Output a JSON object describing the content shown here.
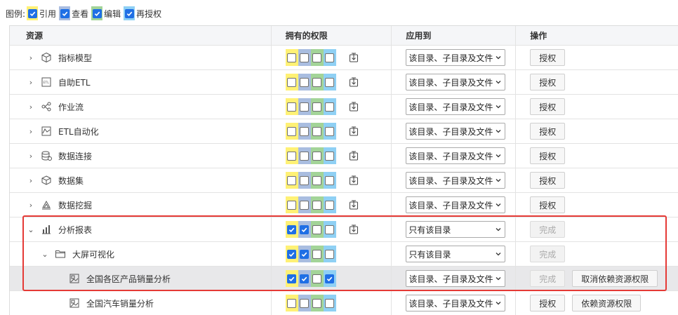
{
  "legend": {
    "prefix": "图例:",
    "items": [
      {
        "label": "引用",
        "color": "#fff175"
      },
      {
        "label": "查看",
        "color": "#a9bde0"
      },
      {
        "label": "编辑",
        "color": "#a3d498"
      },
      {
        "label": "再授权",
        "color": "#8fd0f4"
      }
    ]
  },
  "table": {
    "headers": {
      "resource": "资源",
      "permissions": "拥有的权限",
      "apply_to": "应用到",
      "actions": "操作"
    },
    "rows": [
      {
        "label": "指标模型",
        "expander": "›",
        "icon": "cube-icon",
        "perms": [
          false,
          false,
          false,
          false
        ],
        "inherit": true,
        "apply": "该目录、子目录及文件",
        "actions": [
          "授权"
        ],
        "disabled": [
          false
        ]
      },
      {
        "label": "自助ETL",
        "expander": "›",
        "icon": "etl-icon",
        "perms": [
          false,
          false,
          false,
          false
        ],
        "inherit": true,
        "apply": "该目录、子目录及文件",
        "actions": [
          "授权"
        ],
        "disabled": [
          false
        ]
      },
      {
        "label": "作业流",
        "expander": "›",
        "icon": "workflow-icon",
        "perms": [
          false,
          false,
          false,
          false
        ],
        "inherit": true,
        "apply": "该目录、子目录及文件",
        "actions": [
          "授权"
        ],
        "disabled": [
          false
        ]
      },
      {
        "label": "ETL自动化",
        "expander": "›",
        "icon": "etl-automation-icon",
        "perms": [
          false,
          false,
          false,
          false
        ],
        "inherit": true,
        "apply": "该目录、子目录及文件",
        "actions": [
          "授权"
        ],
        "disabled": [
          false
        ]
      },
      {
        "label": "数据连接",
        "expander": "›",
        "icon": "database-icon",
        "perms": [
          false,
          false,
          false,
          false
        ],
        "inherit": true,
        "apply": "该目录、子目录及文件",
        "actions": [
          "授权"
        ],
        "disabled": [
          false
        ]
      },
      {
        "label": "数据集",
        "expander": "›",
        "icon": "dataset-icon",
        "perms": [
          false,
          false,
          false,
          false
        ],
        "inherit": true,
        "apply": "该目录、子目录及文件",
        "actions": [
          "授权"
        ],
        "disabled": [
          false
        ]
      },
      {
        "label": "数据挖掘",
        "expander": "›",
        "icon": "mining-icon",
        "perms": [
          false,
          false,
          false,
          false
        ],
        "inherit": true,
        "apply": "该目录、子目录及文件",
        "actions": [
          "授权"
        ],
        "disabled": [
          false
        ]
      },
      {
        "label": "分析报表",
        "expander": "⌄",
        "icon": "report-icon",
        "perms": [
          true,
          true,
          false,
          false
        ],
        "inherit": true,
        "apply": "只有该目录",
        "actions": [
          "完成"
        ],
        "disabled": [
          true
        ]
      },
      {
        "label": "大屏可视化",
        "expander": "⌄",
        "icon": "folder-icon",
        "perms": [
          true,
          true,
          false,
          false
        ],
        "inherit": false,
        "apply": "只有该目录",
        "actions": [
          "完成"
        ],
        "disabled": [
          true
        ]
      },
      {
        "label": "全国各区产品销量分析",
        "expander": "",
        "icon": "image-icon",
        "perms": [
          true,
          true,
          false,
          true
        ],
        "inherit": false,
        "apply": "该目录、子目录及文件",
        "actions": [
          "完成",
          "取消依赖资源权限"
        ],
        "disabled": [
          true,
          false
        ],
        "selected": true
      },
      {
        "label": "全国汽车销量分析",
        "expander": "",
        "icon": "image-icon",
        "perms": [
          false,
          false,
          false,
          false
        ],
        "inherit": false,
        "apply": "该目录、子目录及文件",
        "actions": [
          "授权",
          "依赖资源权限"
        ],
        "disabled": [
          false,
          false
        ]
      }
    ]
  }
}
